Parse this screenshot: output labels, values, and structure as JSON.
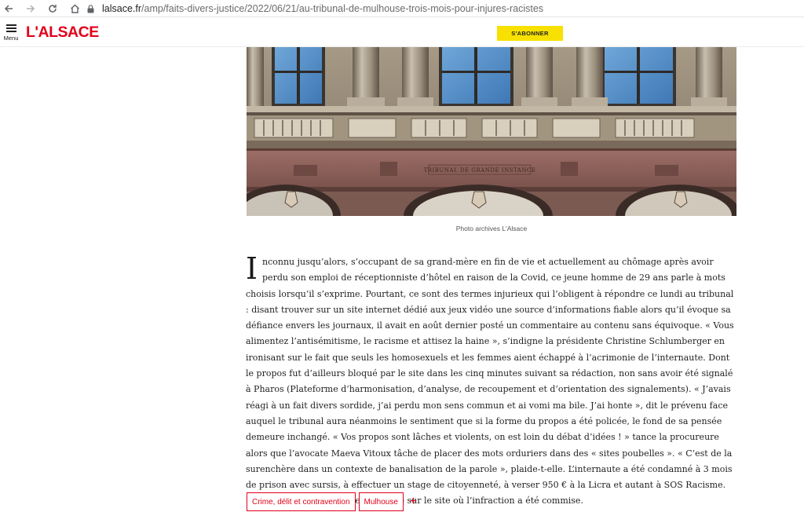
{
  "browser": {
    "url_domain": "lalsace.fr",
    "url_path": "/amp/faits-divers-justice/2022/06/21/au-tribunal-de-mulhouse-trois-mois-pour-injures-racistes",
    "icons": [
      "back-arrow-icon",
      "forward-arrow-icon",
      "reload-icon",
      "home-icon",
      "lock-icon"
    ]
  },
  "header": {
    "menu_label": "Menu",
    "logo_text": "L'ALSACE",
    "subscribe_label": "S'ABONNER",
    "colors": {
      "brand": "#e2001a",
      "subscribe_bg": "#f8e100"
    }
  },
  "photo": {
    "caption": "Photo archives L'Alsace",
    "engraved_text": "TRIBUNAL DE GRANDE INSTANCE"
  },
  "article": {
    "drop_cap": "I",
    "body": "nconnu jusqu’alors, s’occupant de sa grand-mère en fin de vie et actuellement au chômage après avoir perdu son emploi de réceptionniste d’hôtel en raison de la Covid, ce jeune homme de 29 ans parle à mots choisis lorsqu’il s’exprime. Pourtant, ce sont des termes injurieux qui l’obligent à répondre ce lundi au tribunal : disant trouver sur un site internet dédié aux jeux vidéo une source d’informations fiable alors qu’il évoque sa défiance envers les journaux, il avait en août dernier posté un commentaire au contenu sans équivoque. « Vous alimentez l’antisémitisme, le racisme et attisez la haine », s’indigne la présidente Christine Schlumberger en ironisant sur le fait que seuls les homosexuels et les femmes aient échappé à l’acrimonie de l’internaute. Dont le propos fut d’ailleurs bloqué par le site dans les cinq minutes suivant sa rédaction, non sans avoir été signalé à Pharos (Plateforme d‘harmonisation, d’analyse, de recoupement et d’orientation des signalements). « J’avais réagi à un fait divers sordide, j’ai perdu mon sens commun et ai vomi ma bile. J’ai honte », dit le prévenu face auquel le tribunal aura néanmoins le sentiment que si la forme du propos a été policée, le fond de sa pensée demeure inchangé. « Vos propos sont lâches et violents, on est loin du débat d’idées ! » tance la procureure alors que l’avocate Maeva Vitoux tâche de placer des mots orduriers dans des « sites poubelles ». « C’est de la surenchère dans un contexte de banalisation de la parole », plaide-t-elle. L’internaute a été condamné à 3 mois de prison avec sursis, à effectuer un stage de citoyenneté, à verser 950 € à la Licra et autant à SOS Racisme. Son identité sera également publiée sur le site où l’infraction a été commise."
  },
  "tags": {
    "items": [
      "Crime, délit et contravention",
      "Mulhouse"
    ],
    "more": "+"
  }
}
